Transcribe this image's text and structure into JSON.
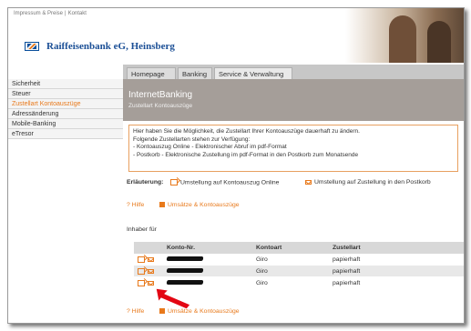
{
  "header": {
    "nav_left": "Impressum & Preise",
    "nav_sep": "|",
    "nav_right": "Kontakt",
    "bank_name": "Raiffeisenbank eG, Heinsberg"
  },
  "tabs": [
    "Homepage",
    "Banking",
    "Service & Verwaltung"
  ],
  "sidebar": {
    "items": [
      {
        "label": "Sicherheit",
        "active": false
      },
      {
        "label": "Steuer",
        "active": false
      },
      {
        "label": "Zustellart Kontoauszüge",
        "active": true
      },
      {
        "label": "Adressänderung",
        "active": false
      },
      {
        "label": "Mobile-Banking",
        "active": false
      },
      {
        "label": "eTresor",
        "active": false
      }
    ]
  },
  "banner": {
    "title": "InternetBanking",
    "subtitle": "Zustellart Kontoauszüge"
  },
  "info": {
    "lines": [
      "Hier haben Sie die Möglichkeit, die Zustellart Ihrer Kontoauszüge dauerhaft zu ändern.",
      "Folgende Zustellarten stehen zur Verfügung:",
      "- Kontoauszug Online - Elektronischer Abruf im pdf-Format",
      "- Postkorb - Elektronische Zustellung im pdf-Format in den Postkorb zum Monatsende"
    ]
  },
  "legend": {
    "label": "Erläuterung:",
    "online": "Umstellung auf Kontoauszug Online",
    "postkorb": "Umstellung auf Zustellung in den Postkorb"
  },
  "links": {
    "help": "? Hilfe",
    "umsaetze": "Umsätze & Kontoauszüge"
  },
  "owner_label": "Inhaber für",
  "table": {
    "headers": [
      "Konto-Nr.",
      "Kontoart",
      "Zustellart"
    ],
    "rows": [
      {
        "kontoart": "Giro",
        "zustellart": "papierhaft"
      },
      {
        "kontoart": "Giro",
        "zustellart": "papierhaft"
      },
      {
        "kontoart": "Giro",
        "zustellart": "papierhaft"
      }
    ]
  },
  "colors": {
    "accent_orange": "#e8791b",
    "brand_blue": "#1b4f96",
    "arrow_red": "#e30613"
  }
}
